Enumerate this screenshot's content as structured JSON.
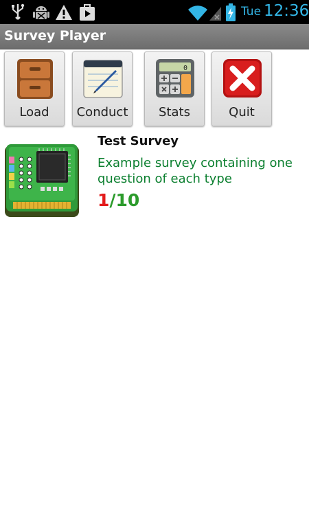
{
  "status_bar": {
    "day": "Tue",
    "time": "12:36",
    "icons": [
      "usb-icon",
      "android-debug-icon",
      "warning-icon",
      "play-store-icon",
      "wifi-icon",
      "cell-signal-icon",
      "battery-charging-icon"
    ],
    "accent": "#33b5e5"
  },
  "app": {
    "title": "Survey Player"
  },
  "toolbar": {
    "load_label": "Load",
    "conduct_label": "Conduct",
    "stats_label": "Stats",
    "quit_label": "Quit"
  },
  "surveys": [
    {
      "title": "Test Survey",
      "description": "Example survey containing one question of each type",
      "progress_current": "1",
      "progress_rest": "/10",
      "colors": {
        "current": "#e31b1b",
        "total": "#2c9b2c",
        "description": "#0b7f2f"
      }
    }
  ]
}
